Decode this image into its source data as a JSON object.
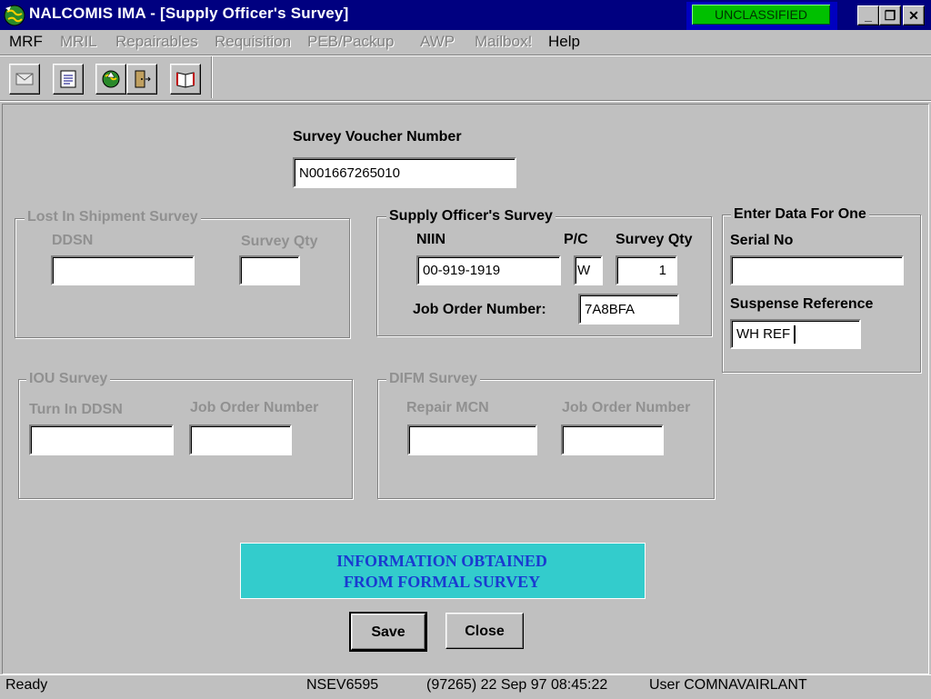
{
  "window": {
    "title": "NALCOMIS IMA - [Supply Officer's Survey]",
    "classification": "UNCLASSIFIED",
    "controls": {
      "minimize": "_",
      "restore": "❐",
      "close": "✕"
    }
  },
  "menu": [
    {
      "label": "MRF",
      "enabled": true
    },
    {
      "label": "MRIL",
      "enabled": false
    },
    {
      "label": "Repairables",
      "enabled": false
    },
    {
      "label": "Requisition",
      "enabled": false
    },
    {
      "label": "PEB/Packup",
      "enabled": false
    },
    {
      "label": "AWP",
      "enabled": false
    },
    {
      "label": "Mailbox!",
      "enabled": false
    },
    {
      "label": "Help",
      "enabled": true
    }
  ],
  "toolbar": {
    "icons": [
      "envelope-icon",
      "notepad-icon",
      "globe-icon",
      "exit-door-icon",
      "book-icon"
    ]
  },
  "form": {
    "survey_voucher": {
      "label": "Survey Voucher Number",
      "value": "N001667265010"
    },
    "lost_in_shipment": {
      "legend": "Lost In Shipment Survey",
      "ddsn_label": "DDSN",
      "ddsn_value": "",
      "qty_label": "Survey Qty",
      "qty_value": ""
    },
    "supply_officer": {
      "legend": "Supply Officer's Survey",
      "niin_label": "NIIN",
      "niin_value": "00-919-1919",
      "pc_label": "P/C",
      "pc_value": "W",
      "qty_label": "Survey Qty",
      "qty_value": "1",
      "job_order_label": "Job Order Number:",
      "job_order_value": "7A8BFA"
    },
    "enter_data": {
      "legend": "Enter Data For One",
      "serial_label": "Serial No",
      "serial_value": "",
      "suspense_label": "Suspense Reference",
      "suspense_value": "WH REF"
    },
    "iou": {
      "legend": "IOU Survey",
      "turn_in_label": "Turn In DDSN",
      "turn_in_value": "",
      "job_order_label": "Job Order Number",
      "job_order_value": ""
    },
    "difm": {
      "legend": "DIFM Survey",
      "repair_label": "Repair MCN",
      "repair_value": "",
      "job_order_label": "Job Order Number",
      "job_order_value": ""
    }
  },
  "info_box": "INFORMATION OBTAINED\nFROM FORMAL SURVEY",
  "buttons": {
    "save": "Save",
    "close": "Close"
  },
  "status": {
    "state": "Ready",
    "terminal": "NSEV6595",
    "datetime": "(97265)  22 Sep 97  08:45:22",
    "user": "User COMNAVAIRLANT"
  }
}
